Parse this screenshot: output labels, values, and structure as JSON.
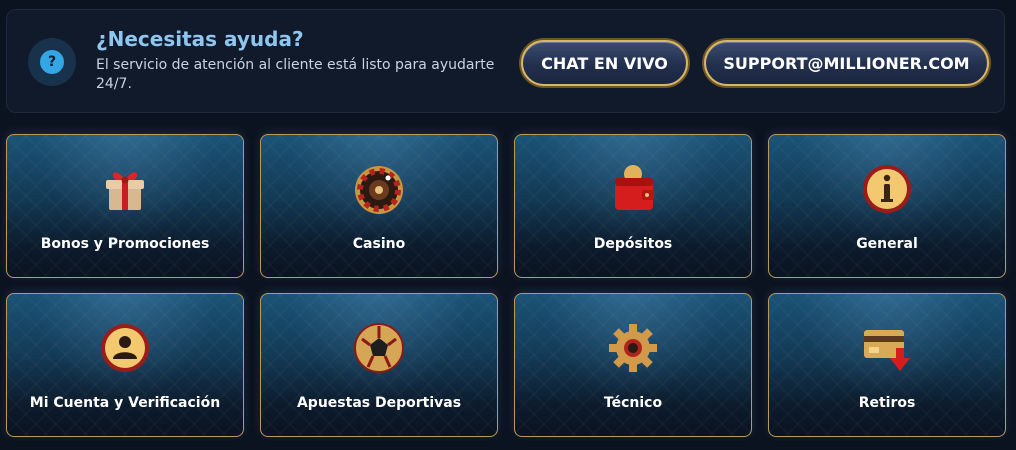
{
  "help": {
    "icon": "question-icon",
    "title": "¿Necesitas ayuda?",
    "description": "El servicio de atención al cliente está listo para ayudarte 24/7.",
    "chat_label": "CHAT EN VIVO",
    "email_label": "SUPPORT@MILLIONER.COM"
  },
  "categories": [
    {
      "label": "Bonos y Promociones",
      "icon": "gift-icon"
    },
    {
      "label": "Casino",
      "icon": "roulette-icon"
    },
    {
      "label": "Depósitos",
      "icon": "wallet-icon"
    },
    {
      "label": "General",
      "icon": "info-icon"
    },
    {
      "label": "Mi Cuenta y Verificación",
      "icon": "user-icon"
    },
    {
      "label": "Apuestas Deportivas",
      "icon": "soccer-ball-icon"
    },
    {
      "label": "Técnico",
      "icon": "gear-icon"
    },
    {
      "label": "Retiros",
      "icon": "card-withdraw-icon"
    }
  ],
  "colors": {
    "background": "#0b1220",
    "accent_gold": "#d9b76a",
    "accent_blue": "#33a7e6",
    "card_top": "#1b5377"
  }
}
